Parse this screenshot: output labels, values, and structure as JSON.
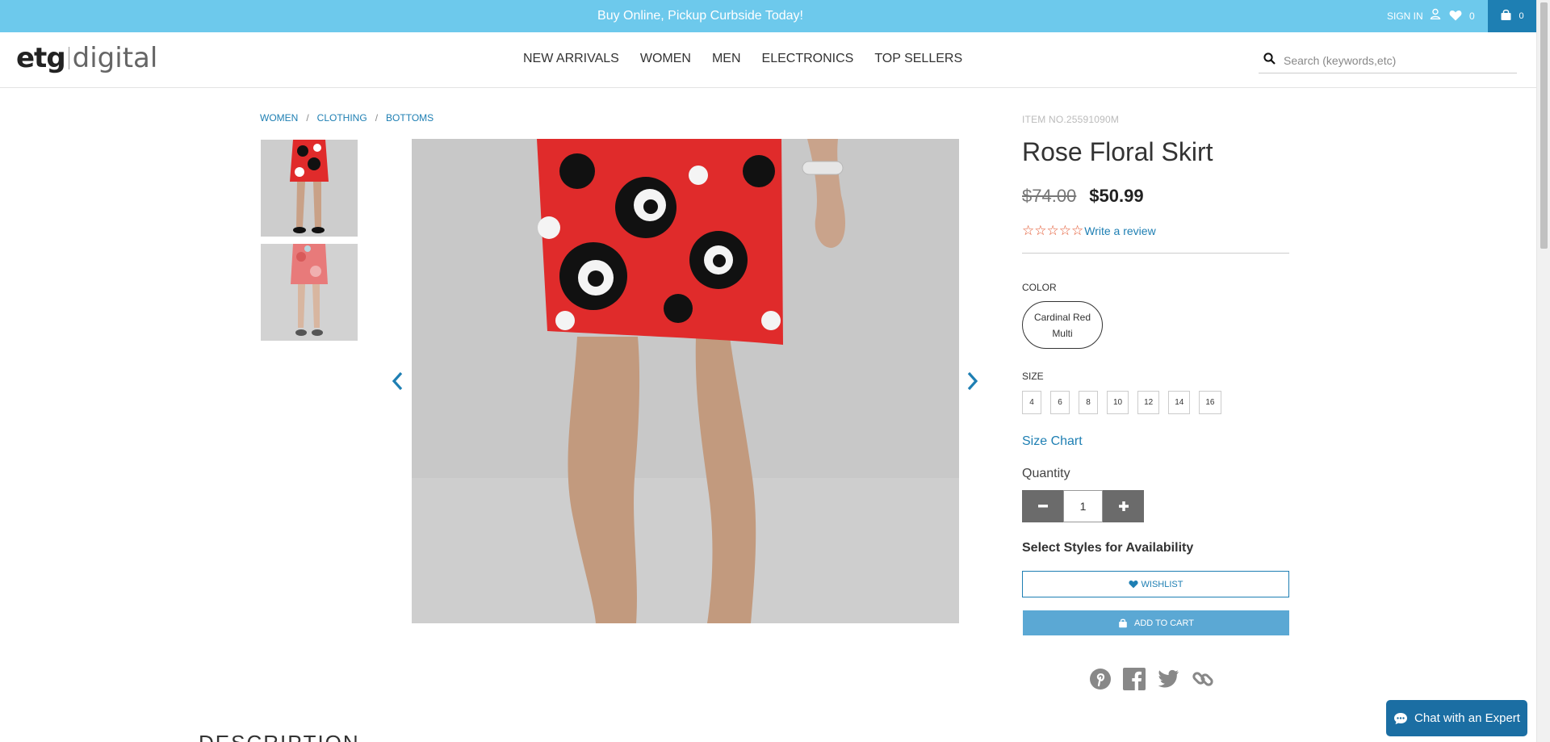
{
  "promo": {
    "message": "Buy Online, Pickup Curbside Today!",
    "signin_label": "SIGN IN",
    "wishlist_count": "0",
    "cart_count": "0"
  },
  "header": {
    "logo_brand": "etg",
    "logo_sub": "digital",
    "nav": [
      "NEW ARRIVALS",
      "WOMEN",
      "MEN",
      "ELECTRONICS",
      "TOP SELLERS"
    ],
    "search_placeholder": "Search (keywords,etc)"
  },
  "breadcrumb": [
    "WOMEN",
    "CLOTHING",
    "BOTTOMS"
  ],
  "breadcrumb_sep": "/",
  "product": {
    "item_no": "ITEM NO.25591090M",
    "title": "Rose Floral Skirt",
    "old_price": "$74.00",
    "price": "$50.99",
    "rating_stars": 0,
    "review_link": "Write a review",
    "color_label": "COLOR",
    "color_line1": "Cardinal Red",
    "color_line2": "Multi",
    "size_label": "SIZE",
    "sizes": [
      "4",
      "6",
      "8",
      "10",
      "12",
      "14",
      "16"
    ],
    "size_chart": "Size Chart",
    "quantity_label": "Quantity",
    "quantity": "1",
    "availability": "Select Styles for Availability",
    "wishlist_button": "WISHLIST",
    "cart_button": "ADD TO CART"
  },
  "description_heading": "DESCRIPTION",
  "chat_label": "Chat with an Expert",
  "colors": {
    "promo_bg": "#6dc9ec",
    "cart_bg": "#1e7fb3",
    "link": "#1e7fb3",
    "star": "#e3562f",
    "add_to_cart": "#5ba8d4",
    "chat_bg": "#1b6ea3",
    "skirt_red": "#e02b2b"
  }
}
